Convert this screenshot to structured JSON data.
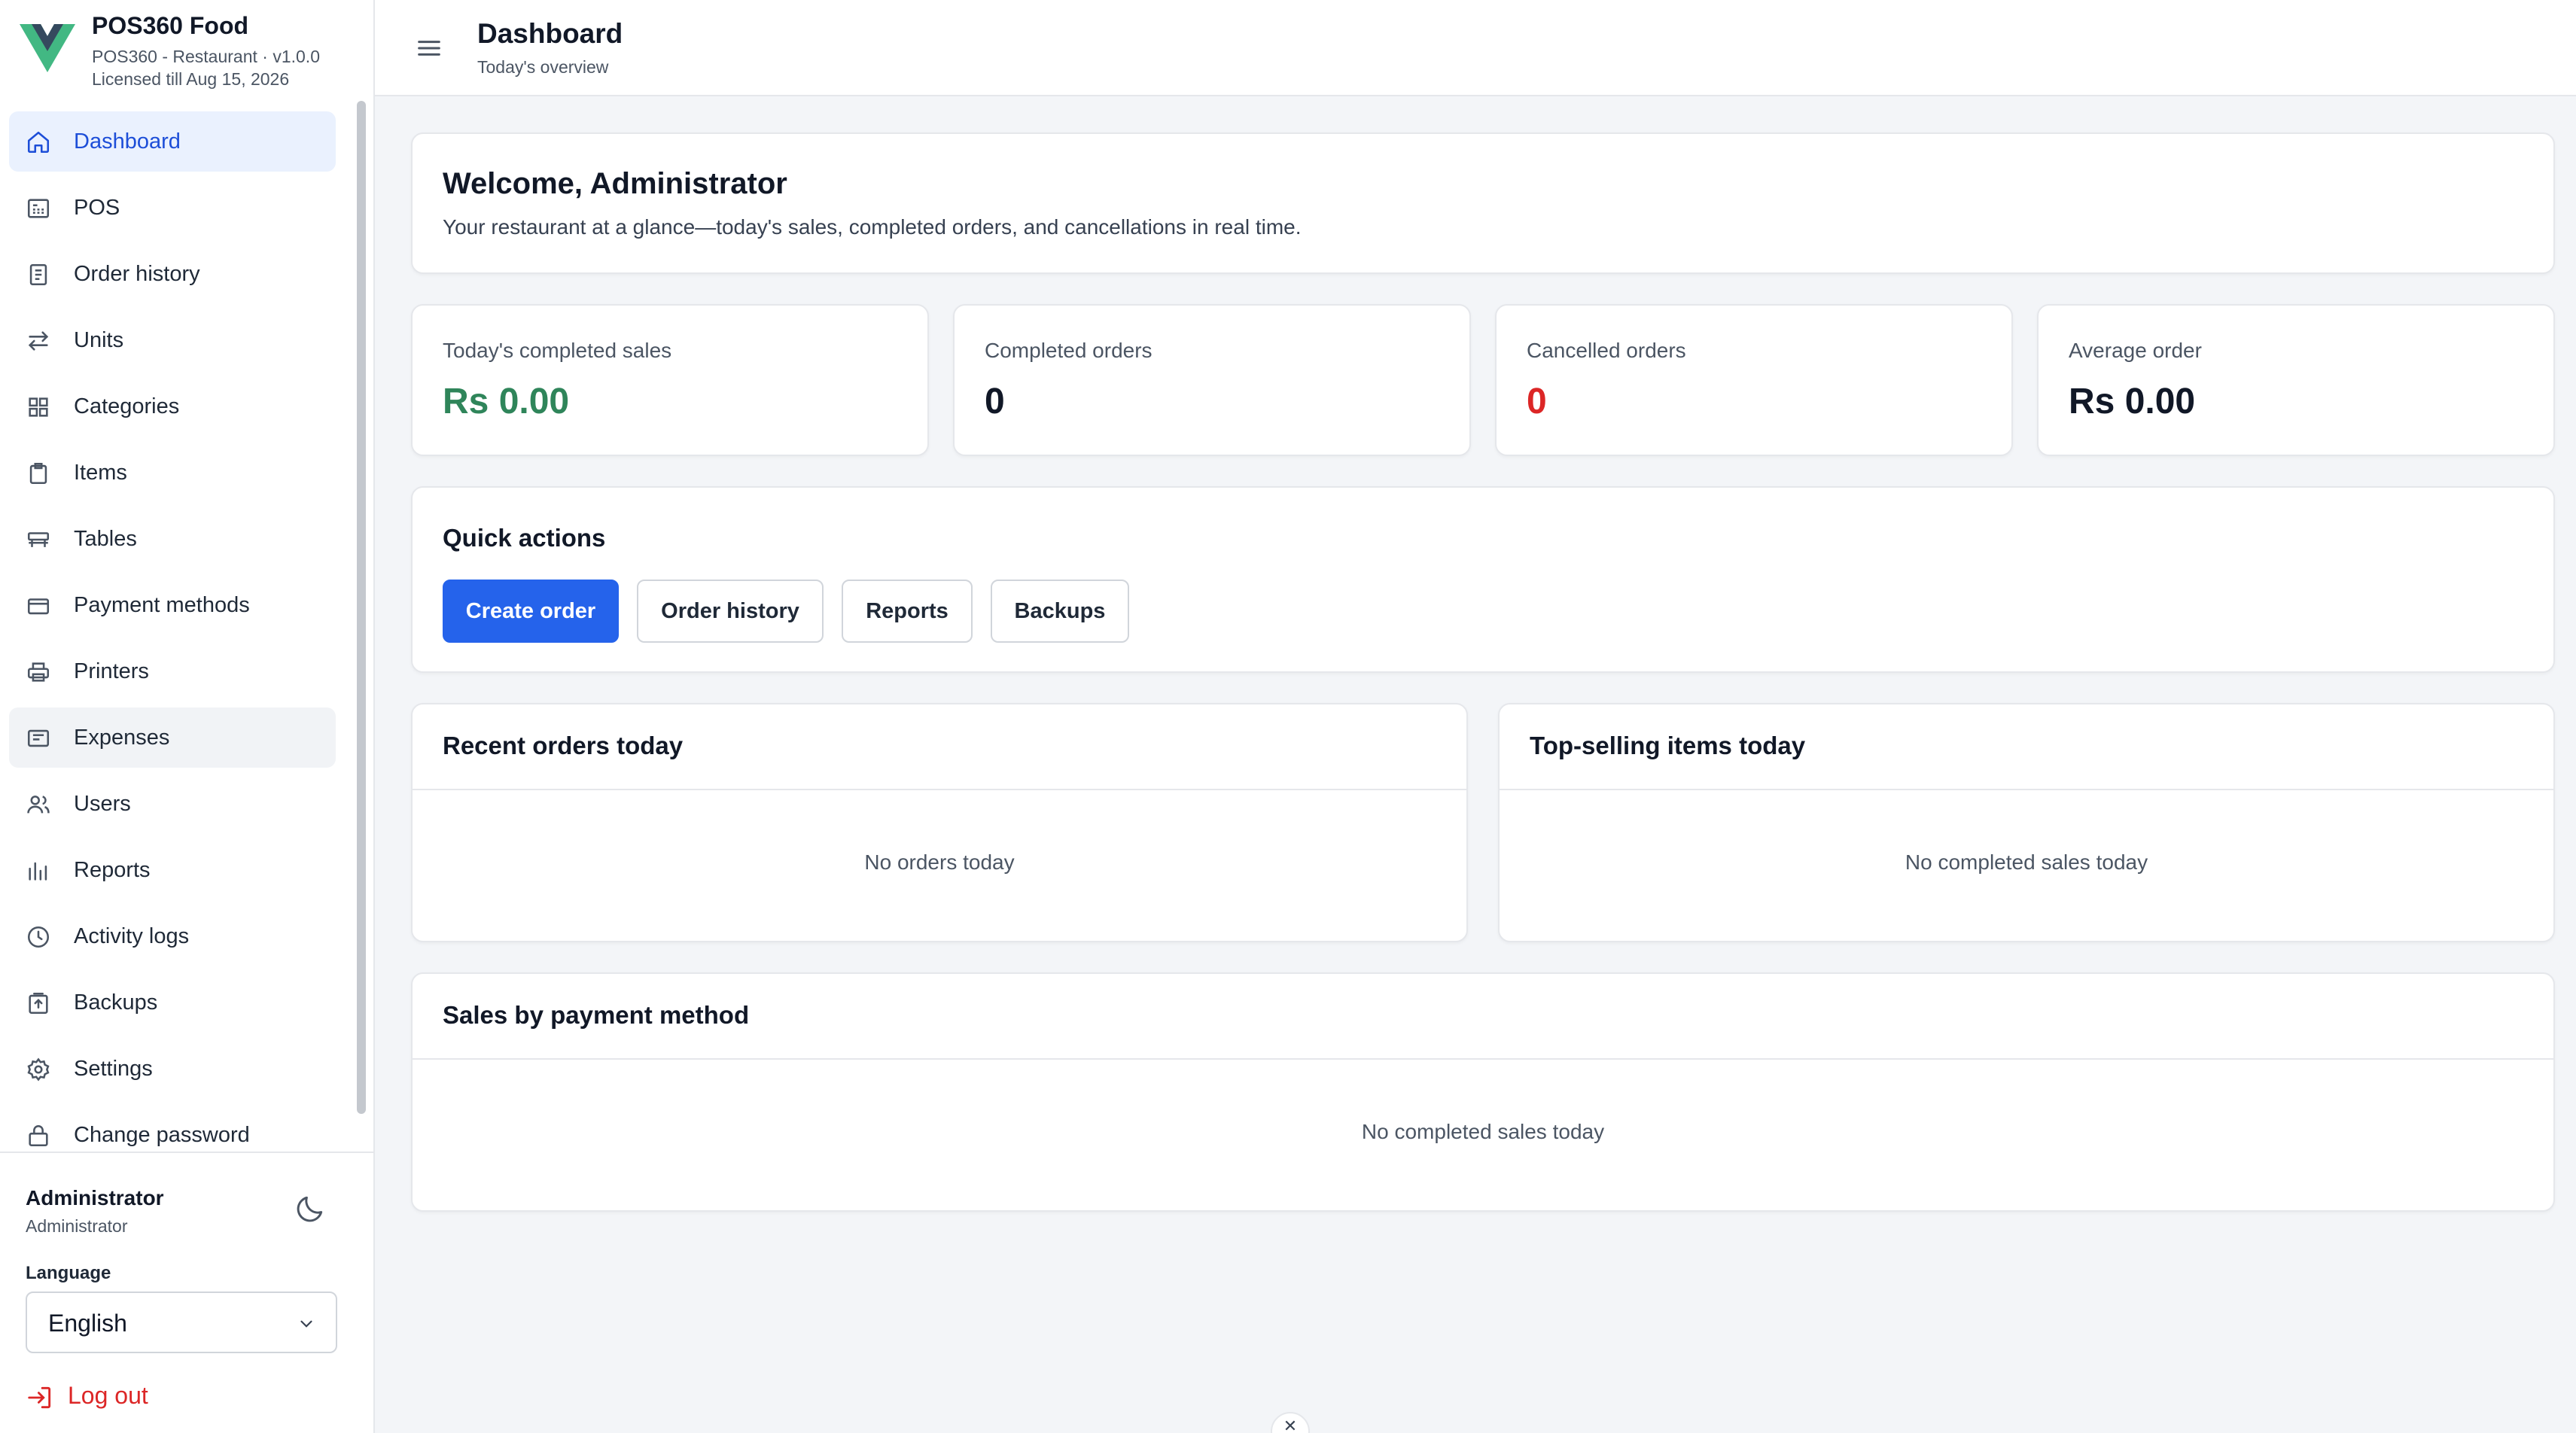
{
  "app": {
    "name": "POS360 Food",
    "version_line": "POS360 - Restaurant · v1.0.0",
    "license_line": "Licensed till Aug 15, 2026",
    "logo_icon": "vue-logo-icon"
  },
  "sidebar": {
    "items": [
      {
        "label": "Dashboard",
        "icon": "home-icon",
        "state": "active"
      },
      {
        "label": "POS",
        "icon": "register-icon"
      },
      {
        "label": "Order history",
        "icon": "receipt-icon"
      },
      {
        "label": "Units",
        "icon": "arrows-icon"
      },
      {
        "label": "Categories",
        "icon": "grid-icon"
      },
      {
        "label": "Items",
        "icon": "clipboard-icon"
      },
      {
        "label": "Tables",
        "icon": "table-icon"
      },
      {
        "label": "Payment methods",
        "icon": "credit-card-icon"
      },
      {
        "label": "Printers",
        "icon": "printer-icon"
      },
      {
        "label": "Expenses",
        "icon": "expense-icon",
        "state": "hover"
      },
      {
        "label": "Users",
        "icon": "users-icon"
      },
      {
        "label": "Reports",
        "icon": "bar-chart-icon"
      },
      {
        "label": "Activity logs",
        "icon": "clock-icon"
      },
      {
        "label": "Backups",
        "icon": "archive-icon"
      },
      {
        "label": "Settings",
        "icon": "gear-icon"
      },
      {
        "label": "Change password",
        "icon": "lock-icon"
      }
    ],
    "user": {
      "name": "Administrator",
      "role": "Administrator"
    },
    "theme_toggle_icon": "moon-icon",
    "language": {
      "label": "Language",
      "selected": "English"
    },
    "logout_label": "Log out"
  },
  "topbar": {
    "title": "Dashboard",
    "subtitle": "Today's overview"
  },
  "welcome": {
    "heading": "Welcome, Administrator",
    "text": "Your restaurant at a glance—today's sales, completed orders, and cancellations in real time."
  },
  "stats": [
    {
      "label": "Today's completed sales",
      "value": "Rs 0.00",
      "color": "#2f855a"
    },
    {
      "label": "Completed orders",
      "value": "0",
      "color": "#111827"
    },
    {
      "label": "Cancelled orders",
      "value": "0",
      "color": "#dc2626"
    },
    {
      "label": "Average order",
      "value": "Rs 0.00",
      "color": "#111827"
    }
  ],
  "quick_actions": {
    "heading": "Quick actions",
    "buttons": [
      "Create order",
      "Order history",
      "Reports",
      "Backups"
    ]
  },
  "recent_orders": {
    "title": "Recent orders today",
    "empty": "No orders today"
  },
  "top_selling": {
    "title": "Top-selling items today",
    "empty": "No completed sales today"
  },
  "payment_sales": {
    "title": "Sales by payment method",
    "empty": "No completed sales today"
  },
  "colors": {
    "accent": "#2563eb",
    "active_nav_bg": "#eaf1fe",
    "success": "#2f855a",
    "danger": "#dc2626",
    "page_bg": "#f3f5f8"
  }
}
